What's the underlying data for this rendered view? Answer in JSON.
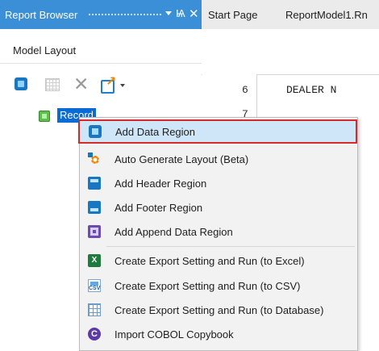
{
  "panel": {
    "title": "Report Browser",
    "pin_glyph": "Ѩ",
    "close_glyph": "✕",
    "section_label": "Model Layout"
  },
  "toolbar": {
    "delete_glyph": "✕",
    "export_glyph": "↗"
  },
  "tree": {
    "selected_node": "Record"
  },
  "editor": {
    "tabs": [
      "Start Page",
      "ReportModel1.Rn"
    ],
    "line_numbers": [
      "6",
      "7"
    ],
    "code_line": "DEALER N"
  },
  "context_menu": {
    "items": [
      {
        "label": "Add Data Region",
        "icon": "add-data-region-icon"
      },
      {
        "label": "Auto Generate Layout (Beta)",
        "icon": "auto-generate-icon"
      },
      {
        "label": "Add Header Region",
        "icon": "header-region-icon"
      },
      {
        "label": "Add Footer Region",
        "icon": "footer-region-icon"
      },
      {
        "label": "Add Append Data Region",
        "icon": "append-data-region-icon"
      },
      {
        "label": "Create Export Setting and Run (to Excel)",
        "icon": "excel-icon"
      },
      {
        "label": "Create Export Setting and Run (to CSV)",
        "icon": "csv-icon"
      },
      {
        "label": "Create Export Setting and Run (to Database)",
        "icon": "database-icon"
      },
      {
        "label": "Import COBOL Copybook",
        "icon": "cobol-icon"
      }
    ],
    "icon_text": {
      "excel": "X",
      "csv": "CSV",
      "cobol": "C"
    }
  },
  "colors": {
    "title_bar": "#3a8fd6",
    "selection": "#0b6bd6",
    "highlight_border": "#d42a2a",
    "menu_bg": "#f2f2f2"
  }
}
